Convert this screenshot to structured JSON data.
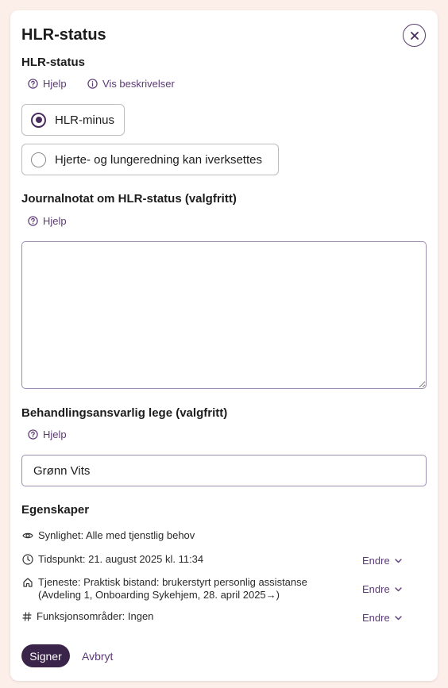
{
  "dialog": {
    "title": "HLR-status",
    "close_icon": "close-icon"
  },
  "hlr": {
    "heading": "HLR-status",
    "help_label": "Hjelp",
    "describe_label": "Vis beskrivelser",
    "options": [
      {
        "label": "HLR-minus",
        "checked": true
      },
      {
        "label": "Hjerte- og lungeredning kan iverksettes",
        "checked": false
      }
    ]
  },
  "note": {
    "heading": "Journalnotat om HLR-status (valgfritt)",
    "help_label": "Hjelp",
    "value": ""
  },
  "doctor": {
    "heading": "Behandlingsansvarlig lege (valgfritt)",
    "help_label": "Hjelp",
    "value": "Grønn Vits"
  },
  "properties": {
    "heading": "Egenskaper",
    "visibility": "Synlighet: Alle med tjenstlig behov",
    "time": "Tidspunkt: 21. august 2025 kl. 11:34",
    "service_line1": "Tjeneste: Praktisk bistand: brukerstyrt personlig assistanse",
    "service_line2": "(Avdeling 1, Onboarding Sykehjem, 28. april 2025→)",
    "functions": "Funksjonsområder: Ingen",
    "change_label": "Endre"
  },
  "actions": {
    "sign_label": "Signer",
    "cancel_label": "Avbryt"
  },
  "colors": {
    "accent": "#5b3a75",
    "primary_button": "#3b2449",
    "background": "#fcefea"
  }
}
